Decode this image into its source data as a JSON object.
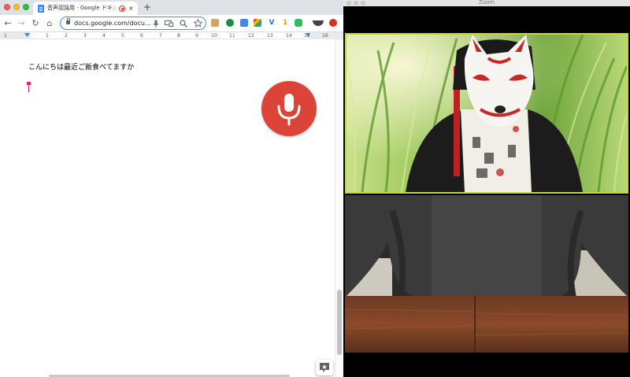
{
  "chrome": {
    "tab": {
      "title": "音声認識用 - Google ドキュメント",
      "close": "×"
    },
    "newtab": "+",
    "toolbar": {
      "back": "←",
      "forward": "→",
      "reload": "↻",
      "home": "⌂",
      "url": "docs.google.com/docu…"
    },
    "ruler": {
      "numbers": [
        "1",
        "1",
        "2",
        "3",
        "4",
        "5",
        "6",
        "7",
        "8",
        "9",
        "10",
        "11",
        "12",
        "13",
        "14",
        "15",
        "16"
      ]
    },
    "extensions": {
      "number_badge": "1"
    }
  },
  "document": {
    "text": "こんにちは最近ご飯食べてますか"
  },
  "zoom": {
    "title": "Zoom"
  },
  "colors": {
    "mic": "#db4437",
    "active_speaker_border": "#c9d43a",
    "cursor": "#e91e63",
    "omnibox_focus": "#4a8af4"
  }
}
